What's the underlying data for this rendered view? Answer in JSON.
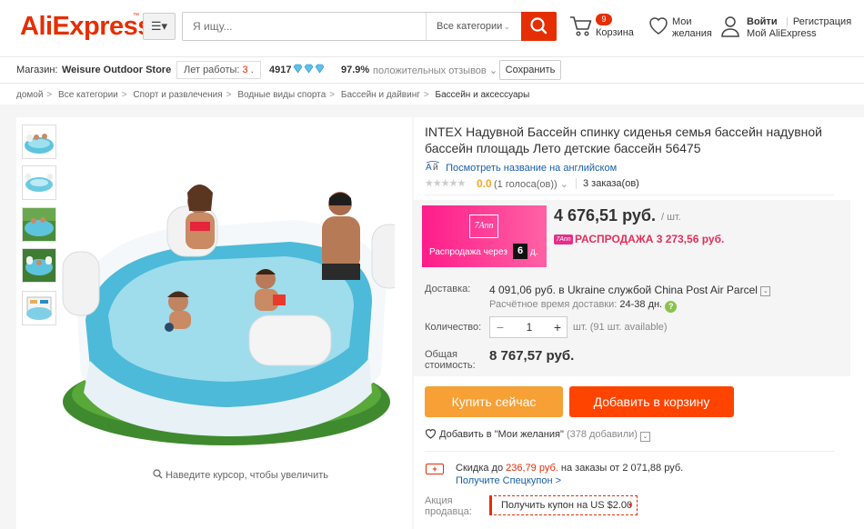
{
  "header": {
    "logo": "AliExpress",
    "search_placeholder": "Я ищу...",
    "category": "Все категории",
    "cart_count": "9",
    "cart_label": "Корзина",
    "wishlist_line1": "Мои",
    "wishlist_line2": "желания",
    "login": "Войти",
    "register": "Регистрация",
    "my_account": "Мой AliExpress"
  },
  "store": {
    "label": "Магазин:",
    "name": "Weisure Outdoor Store",
    "years_label": "Лет работы:",
    "years_value": "3",
    "rating_score": "4917",
    "feedback_percent": "97.9%",
    "feedback_label": "положительных отзывов",
    "save_label": "Сохранить"
  },
  "breadcrumbs": [
    "домой",
    "Все категории",
    "Спорт и развлечения",
    "Водные виды спорта",
    "Бассейн и дайвинг",
    "Бассейн и аксессуары"
  ],
  "gallery": {
    "zoom_hint": "Наведите курсор, чтобы увеличить",
    "thumbnail_count": 5
  },
  "product": {
    "title": "INTEX Надувной Бассейн спинку сиденья семья бассейн надувной бассейн площадь Лето детские бассейн 56475",
    "english_link": "Посмотреть название на английском",
    "rating": "0.0",
    "rating_stars": 0,
    "votes": "(1 голоса(ов))",
    "orders": "3 заказа(ов)",
    "promo_logo": "7Ann",
    "promo_text": "Распродажа через",
    "promo_days": "6",
    "promo_days_label": "д.",
    "price": "4 676,51 руб.",
    "price_unit": "/ шт.",
    "sale_badge": "7Ann",
    "sale_price": "РАСПРОДАЖА 3 273,56 руб."
  },
  "shipping": {
    "label": "Доставка:",
    "line1": "4 091,06 руб. в Ukraine службой China Post Air Parcel",
    "eta_label": "Расчётное время доставки:",
    "eta_value": "24-38 дн."
  },
  "quantity": {
    "label": "Количество:",
    "value": "1",
    "info": "шт. (91 шт. available)"
  },
  "total": {
    "label_line1": "Общая",
    "label_line2": "стоимость:",
    "value": "8 767,57 руб."
  },
  "actions": {
    "buy_now": "Купить сейчас",
    "add_to_cart": "Добавить в корзину",
    "wishlist": "Добавить в \"Мои желания\"",
    "wishlist_count": "(378 добавили)"
  },
  "coupon": {
    "discount_prefix": "Скидка до",
    "discount_amount": "236,79 руб.",
    "discount_suffix": "на заказы от 2 071,88 руб.",
    "special_link": "Получите Спецкупон >",
    "seller_label_line1": "Акция",
    "seller_label_line2": "продавца:",
    "get_coupon": "Получить купон на US $2.00"
  },
  "colors": {
    "brand": "#e62e04",
    "buy_now": "#f7a036",
    "add_to_cart": "#ff4400",
    "promo_pink": "#ff1c8a",
    "link_blue": "#1a5fa8"
  },
  "icons": [
    "menu-icon",
    "search-icon",
    "cart-icon",
    "heart-icon",
    "user-icon",
    "diamond-icon",
    "chevron-down-icon",
    "magnifier-icon",
    "translate-icon",
    "help-icon",
    "coupon-icon"
  ]
}
